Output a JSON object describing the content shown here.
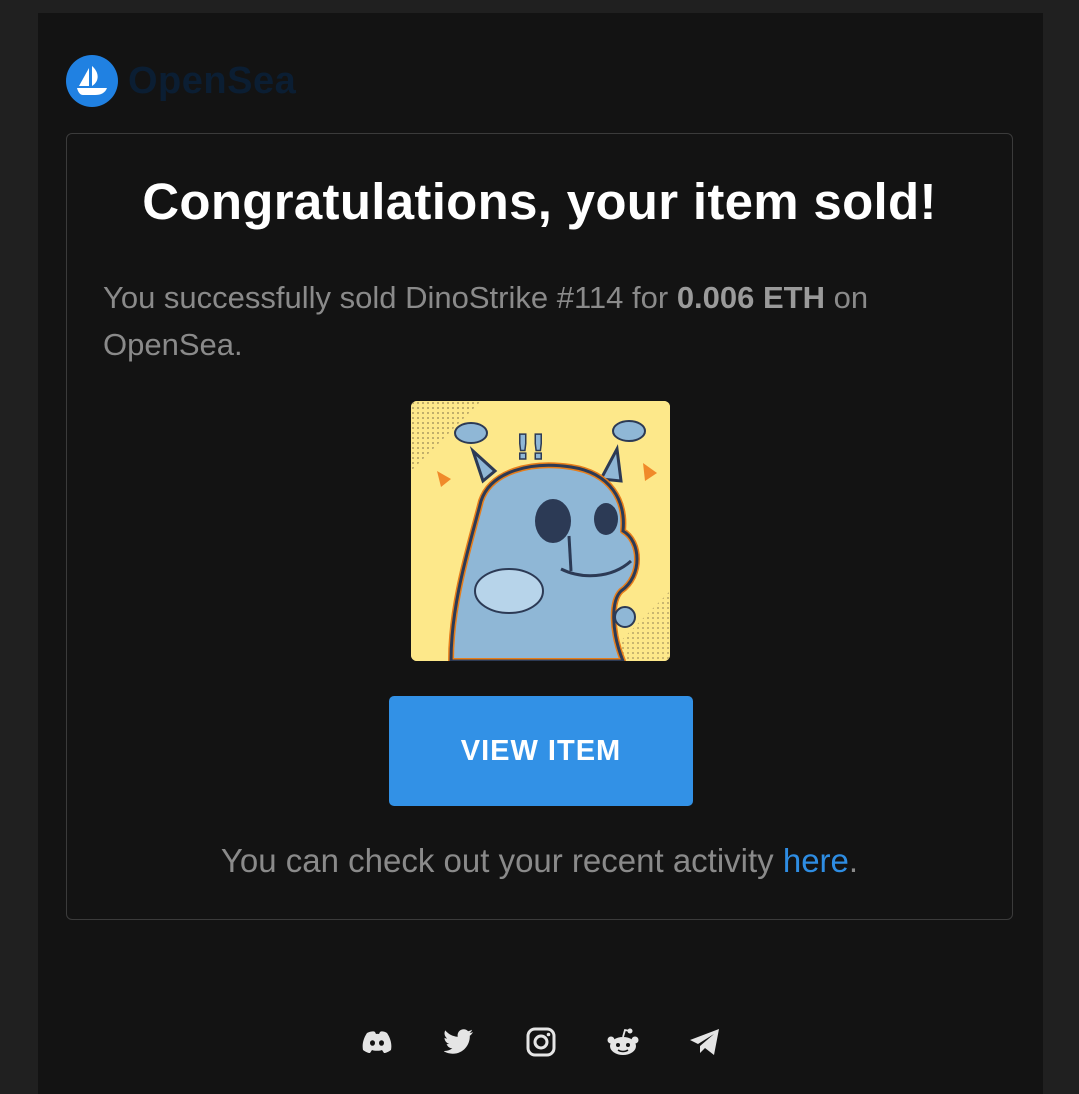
{
  "brand": {
    "name": "OpenSea",
    "logo_icon": "opensea-ship-icon",
    "accent": "#2081e2"
  },
  "card": {
    "title": "Congratulations, your item sold!",
    "message_prefix": "You successfully sold DinoStrike #114 for ",
    "price": "0.006 ETH",
    "message_suffix": " on OpenSea.",
    "image_alt": "DinoStrike #114",
    "button_label": "VIEW ITEM",
    "button_color": "#3291e6",
    "activity_prefix": "You can check out your recent activity ",
    "activity_link": "here",
    "activity_suffix": "."
  },
  "footer": {
    "social_icons": [
      "discord-icon",
      "twitter-icon",
      "instagram-icon",
      "reddit-icon",
      "telegram-icon"
    ]
  }
}
